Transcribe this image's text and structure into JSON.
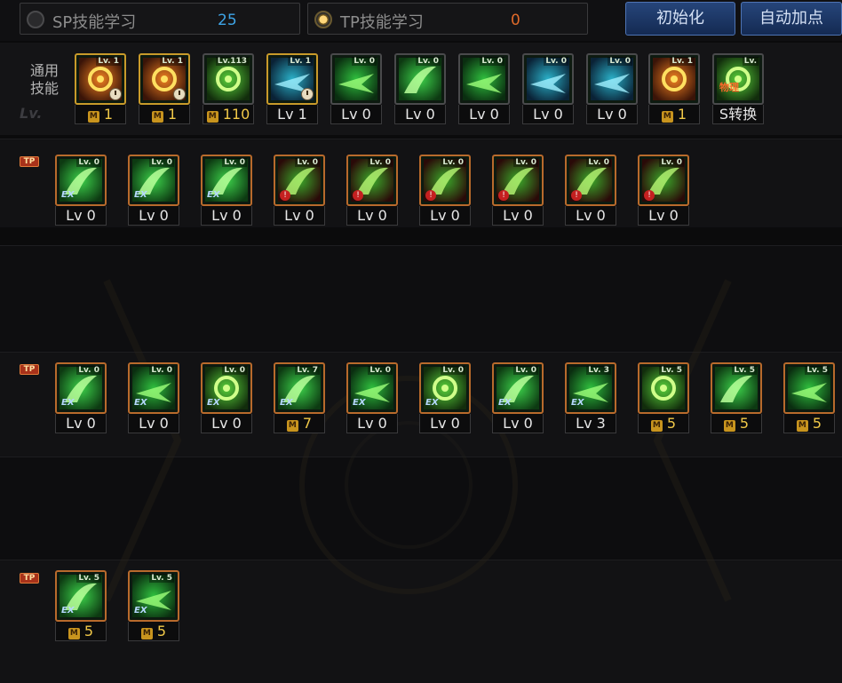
{
  "header": {
    "sp": {
      "label": "SP技能学习",
      "count": "25"
    },
    "tp": {
      "label": "TP技能学习",
      "count": "0"
    },
    "reset_label": "初始化",
    "auto_label": "自动加点"
  },
  "general": {
    "label_line1": "通用",
    "label_line2": "技能",
    "lv_watermark": "Lv.",
    "skills": [
      {
        "lv": "Lv. 1",
        "bottom": "1",
        "mark": "M",
        "icon": "sprint-icon"
      },
      {
        "lv": "Lv. 1",
        "bottom": "1",
        "mark": "M",
        "icon": "leap-icon"
      },
      {
        "lv": "Lv.113",
        "bottom": "110",
        "mark": "M",
        "icon": "strike-icon"
      },
      {
        "lv": "Lv. 1",
        "bottom": "Lv 1",
        "mark": "",
        "icon": "wings-icon"
      },
      {
        "lv": "Lv. 0",
        "bottom": "Lv 0",
        "mark": "",
        "icon": "run-icon"
      },
      {
        "lv": "Lv. 0",
        "bottom": "Lv 0",
        "mark": "",
        "icon": "target-icon"
      },
      {
        "lv": "Lv. 0",
        "bottom": "Lv 0",
        "mark": "",
        "icon": "kneel-icon"
      },
      {
        "lv": "Lv. 0",
        "bottom": "Lv 0",
        "mark": "",
        "icon": "eye-icon"
      },
      {
        "lv": "Lv. 0",
        "bottom": "Lv 0",
        "mark": "",
        "icon": "armor-icon"
      },
      {
        "lv": "Lv. 1",
        "bottom": "1",
        "mark": "M",
        "icon": "fire-burst-icon"
      },
      {
        "lv": "Lv.",
        "bottom": "S转换",
        "mark": "",
        "icon": "convert-icon",
        "text": "物理"
      }
    ]
  },
  "tp_tag": "TP",
  "row1": [
    {
      "lv": "Lv. 0",
      "bottom": "Lv 0",
      "badge": "EX"
    },
    {
      "lv": "Lv. 0",
      "bottom": "Lv 0",
      "badge": "EX"
    },
    {
      "lv": "Lv. 0",
      "bottom": "Lv 0",
      "badge": "EX"
    },
    {
      "lv": "Lv. 0",
      "bottom": "Lv 0",
      "badge": "lock"
    },
    {
      "lv": "Lv. 0",
      "bottom": "Lv 0",
      "badge": "lock"
    },
    {
      "lv": "Lv. 0",
      "bottom": "Lv 0",
      "badge": "lock"
    },
    {
      "lv": "Lv. 0",
      "bottom": "Lv 0",
      "badge": "lock"
    },
    {
      "lv": "Lv. 0",
      "bottom": "Lv 0",
      "badge": "lock"
    },
    {
      "lv": "Lv. 0",
      "bottom": "Lv 0",
      "badge": "lock"
    }
  ],
  "row2": [
    {
      "lv": "Lv. 0",
      "bottom": "Lv 0",
      "mark": ""
    },
    {
      "lv": "Lv. 0",
      "bottom": "Lv 0",
      "mark": ""
    },
    {
      "lv": "Lv. 0",
      "bottom": "Lv 0",
      "mark": ""
    },
    {
      "lv": "Lv. 7",
      "bottom": "7",
      "mark": "M"
    },
    {
      "lv": "Lv. 0",
      "bottom": "Lv 0",
      "mark": ""
    },
    {
      "lv": "Lv. 0",
      "bottom": "Lv 0",
      "mark": ""
    },
    {
      "lv": "Lv. 0",
      "bottom": "Lv 0",
      "mark": ""
    },
    {
      "lv": "Lv. 3",
      "bottom": "Lv 3",
      "mark": ""
    },
    {
      "lv": "Lv. 5",
      "bottom": "5",
      "mark": "M"
    },
    {
      "lv": "Lv. 5",
      "bottom": "5",
      "mark": "M"
    },
    {
      "lv": "Lv. 5",
      "bottom": "5",
      "mark": "M"
    }
  ],
  "row3": [
    {
      "lv": "Lv. 5",
      "bottom": "5",
      "mark": "M"
    },
    {
      "lv": "Lv. 5",
      "bottom": "5",
      "mark": "M"
    }
  ],
  "ex_badge": "EX",
  "colors": {
    "sp_count": "#3ea4e6",
    "tp_count": "#e06a2a",
    "button": "#1c3562"
  }
}
